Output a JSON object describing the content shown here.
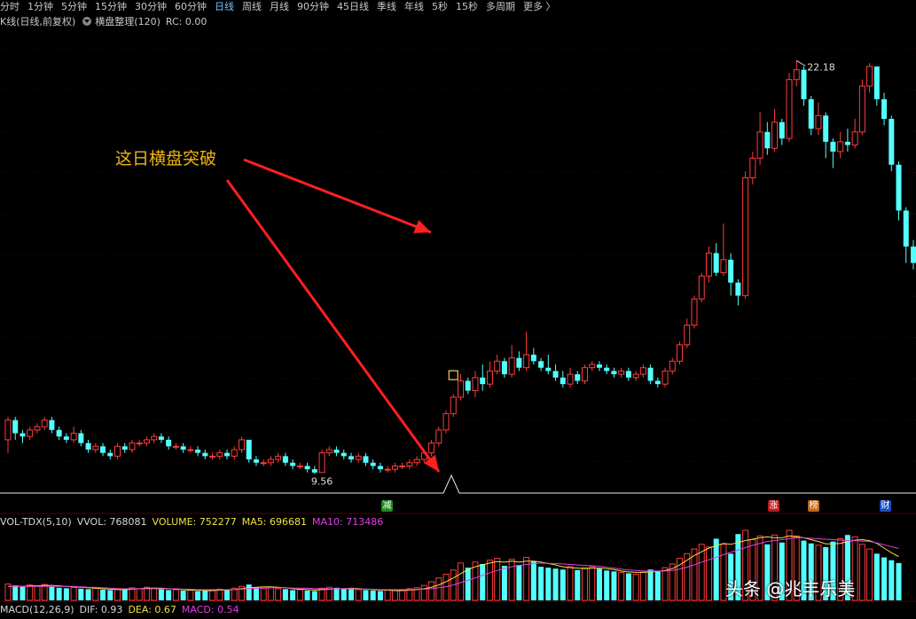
{
  "timeframes": [
    "分时",
    "1分钟",
    "5分钟",
    "15分钟",
    "30分钟",
    "60分钟",
    "日线",
    "周线",
    "月线",
    "90分钟",
    "45日线",
    "季线",
    "年线",
    "5秒",
    "15秒",
    "多周期",
    "更多 〉"
  ],
  "active_timeframe": "日线",
  "info_bar": {
    "chart_label": "K线(日线,前复权)",
    "indicator_label": "横盘整理(120)",
    "rc_label": "RC: 0.00"
  },
  "price_labels": {
    "high": "22.18",
    "low": "9.56"
  },
  "annotation": "这日横盘突破",
  "badges": [
    {
      "text": "减",
      "color": "#1f8a1f"
    },
    {
      "text": "涨",
      "color": "#c01818"
    },
    {
      "text": "榜",
      "color": "#c06818"
    },
    {
      "text": "财",
      "color": "#1a4fbf"
    }
  ],
  "volume_bar": {
    "name": "VOL-TDX(5,10)",
    "vvol": "VVOL: 768081",
    "volume": "VOLUME: 752277",
    "ma5": "MA5: 696681",
    "ma10": "MA10: 713486"
  },
  "macd_bar": {
    "name": "MACD(12,26,9)",
    "dif": "DIF: 0.93",
    "dea": "DEA: 0.67",
    "macd": "MACD: 0.54"
  },
  "watermark": "头条 @兆丰乐美",
  "colors": {
    "up": "#ff3c3c",
    "down": "#54ffff",
    "background": "#000000",
    "accent": "#f2b50e"
  },
  "chart_data": {
    "type": "candlestick",
    "title": "",
    "y_range": [
      9.0,
      23.0
    ],
    "candles": [
      [
        10.6,
        11.2,
        10.2,
        11.3
      ],
      [
        11.2,
        10.8,
        10.6,
        11.3
      ],
      [
        10.8,
        10.7,
        10.5,
        10.9
      ],
      [
        10.7,
        10.9,
        10.6,
        11.0
      ],
      [
        10.9,
        11.0,
        10.8,
        11.1
      ],
      [
        11.0,
        11.2,
        10.9,
        11.3
      ],
      [
        11.2,
        10.9,
        10.8,
        11.3
      ],
      [
        10.9,
        10.7,
        10.6,
        11.0
      ],
      [
        10.7,
        10.6,
        10.5,
        10.8
      ],
      [
        10.6,
        10.8,
        10.5,
        11.0
      ],
      [
        10.8,
        10.5,
        10.4,
        10.9
      ],
      [
        10.5,
        10.3,
        10.2,
        10.6
      ],
      [
        10.3,
        10.4,
        10.2,
        10.5
      ],
      [
        10.4,
        10.2,
        10.1,
        10.5
      ],
      [
        10.2,
        10.1,
        10.0,
        10.3
      ],
      [
        10.1,
        10.4,
        10.0,
        10.5
      ],
      [
        10.4,
        10.3,
        10.2,
        10.5
      ],
      [
        10.3,
        10.5,
        10.2,
        10.6
      ],
      [
        10.5,
        10.5,
        10.4,
        10.6
      ],
      [
        10.5,
        10.6,
        10.4,
        10.7
      ],
      [
        10.6,
        10.7,
        10.5,
        10.8
      ],
      [
        10.7,
        10.6,
        10.5,
        10.8
      ],
      [
        10.6,
        10.4,
        10.3,
        10.7
      ],
      [
        10.4,
        10.4,
        10.3,
        10.5
      ],
      [
        10.4,
        10.3,
        10.2,
        10.5
      ],
      [
        10.3,
        10.3,
        10.2,
        10.4
      ],
      [
        10.3,
        10.2,
        10.1,
        10.4
      ],
      [
        10.2,
        10.1,
        10.0,
        10.3
      ],
      [
        10.1,
        10.1,
        10.0,
        10.2
      ],
      [
        10.1,
        10.2,
        10.0,
        10.3
      ],
      [
        10.2,
        10.1,
        10.0,
        10.3
      ],
      [
        10.1,
        10.3,
        10.0,
        10.4
      ],
      [
        10.3,
        10.6,
        10.2,
        10.7
      ],
      [
        10.6,
        10.0,
        9.9,
        10.6
      ],
      [
        10.0,
        9.9,
        9.8,
        10.1
      ],
      [
        9.9,
        9.9,
        9.8,
        10.0
      ],
      [
        9.9,
        10.0,
        9.8,
        10.1
      ],
      [
        10.0,
        10.1,
        9.9,
        10.2
      ],
      [
        10.1,
        9.9,
        9.8,
        10.2
      ],
      [
        9.9,
        9.8,
        9.7,
        10.0
      ],
      [
        9.8,
        9.8,
        9.7,
        9.9
      ],
      [
        9.8,
        9.7,
        9.6,
        9.9
      ],
      [
        9.7,
        9.6,
        9.56,
        9.8
      ],
      [
        9.6,
        10.2,
        9.6,
        10.3
      ],
      [
        10.2,
        10.3,
        10.1,
        10.4
      ],
      [
        10.3,
        10.2,
        10.1,
        10.4
      ],
      [
        10.2,
        10.1,
        10.0,
        10.3
      ],
      [
        10.1,
        10.0,
        9.9,
        10.2
      ],
      [
        10.0,
        10.1,
        9.9,
        10.2
      ],
      [
        10.1,
        9.9,
        9.8,
        10.2
      ],
      [
        9.9,
        9.8,
        9.7,
        10.0
      ],
      [
        9.8,
        9.7,
        9.6,
        9.9
      ],
      [
        9.7,
        9.7,
        9.6,
        9.8
      ],
      [
        9.7,
        9.8,
        9.6,
        9.9
      ],
      [
        9.8,
        9.8,
        9.7,
        9.9
      ],
      [
        9.8,
        9.9,
        9.7,
        10.0
      ],
      [
        9.9,
        10.0,
        9.8,
        10.1
      ],
      [
        10.0,
        10.2,
        9.9,
        10.3
      ],
      [
        10.2,
        10.5,
        10.1,
        10.6
      ],
      [
        10.5,
        10.9,
        10.4,
        11.0
      ],
      [
        10.9,
        11.4,
        10.8,
        11.5
      ],
      [
        11.4,
        11.9,
        11.3,
        12.0
      ],
      [
        11.9,
        12.4,
        11.8,
        12.6
      ],
      [
        12.4,
        12.1,
        12.0,
        12.5
      ],
      [
        12.1,
        12.5,
        11.9,
        12.7
      ],
      [
        12.5,
        12.3,
        12.1,
        12.9
      ],
      [
        12.3,
        12.7,
        12.2,
        13.0
      ],
      [
        12.7,
        13.0,
        12.6,
        13.2
      ],
      [
        13.0,
        12.6,
        12.5,
        13.1
      ],
      [
        12.6,
        13.1,
        12.5,
        13.5
      ],
      [
        13.1,
        12.8,
        12.7,
        13.3
      ],
      [
        12.8,
        13.2,
        12.7,
        13.9
      ],
      [
        13.2,
        13.0,
        12.9,
        13.4
      ],
      [
        13.0,
        12.8,
        12.7,
        13.1
      ],
      [
        12.8,
        12.7,
        12.6,
        13.2
      ],
      [
        12.7,
        12.5,
        12.4,
        12.9
      ],
      [
        12.5,
        12.3,
        12.2,
        12.7
      ],
      [
        12.3,
        12.6,
        12.2,
        12.8
      ],
      [
        12.6,
        12.4,
        12.3,
        12.7
      ],
      [
        12.4,
        12.8,
        12.3,
        12.9
      ],
      [
        12.8,
        12.9,
        12.7,
        13.0
      ],
      [
        12.9,
        12.8,
        12.7,
        13.0
      ],
      [
        12.8,
        12.7,
        12.6,
        12.9
      ],
      [
        12.7,
        12.6,
        12.5,
        12.8
      ],
      [
        12.6,
        12.7,
        12.5,
        12.8
      ],
      [
        12.7,
        12.5,
        12.4,
        12.8
      ],
      [
        12.5,
        12.6,
        12.4,
        12.7
      ],
      [
        12.6,
        12.8,
        12.5,
        12.9
      ],
      [
        12.8,
        12.4,
        12.3,
        12.9
      ],
      [
        12.4,
        12.3,
        12.2,
        12.5
      ],
      [
        12.3,
        12.7,
        12.2,
        12.8
      ],
      [
        12.7,
        13.0,
        12.6,
        13.1
      ],
      [
        13.0,
        13.5,
        12.9,
        13.6
      ],
      [
        13.5,
        14.1,
        13.4,
        14.3
      ],
      [
        14.1,
        14.9,
        14.0,
        15.0
      ],
      [
        14.9,
        15.6,
        14.8,
        15.7
      ],
      [
        15.6,
        16.3,
        15.4,
        16.5
      ],
      [
        16.3,
        15.7,
        15.6,
        16.6
      ],
      [
        15.7,
        16.1,
        15.6,
        17.2
      ],
      [
        16.1,
        15.4,
        15.0,
        16.3
      ],
      [
        15.4,
        15.0,
        14.7,
        15.5
      ],
      [
        15.0,
        18.6,
        14.9,
        18.8
      ],
      [
        18.6,
        19.2,
        18.4,
        19.4
      ],
      [
        19.2,
        20.0,
        19.0,
        20.6
      ],
      [
        20.0,
        19.5,
        19.3,
        20.3
      ],
      [
        19.5,
        20.3,
        19.4,
        20.7
      ],
      [
        20.3,
        19.8,
        19.6,
        20.4
      ],
      [
        19.8,
        21.6,
        19.7,
        21.8
      ],
      [
        21.6,
        21.9,
        21.4,
        22.18
      ],
      [
        21.9,
        21.0,
        20.8,
        22.0
      ],
      [
        21.0,
        20.1,
        19.9,
        21.1
      ],
      [
        20.1,
        20.5,
        19.9,
        20.9
      ],
      [
        20.5,
        19.7,
        19.2,
        20.6
      ],
      [
        19.7,
        19.4,
        18.9,
        19.8
      ],
      [
        19.4,
        19.7,
        19.2,
        20.0
      ],
      [
        19.7,
        19.6,
        19.4,
        20.1
      ],
      [
        19.6,
        20.0,
        19.5,
        20.4
      ],
      [
        20.0,
        21.4,
        19.9,
        21.6
      ],
      [
        21.4,
        22.0,
        21.2,
        22.1
      ],
      [
        22.0,
        21.0,
        20.8,
        22.0
      ],
      [
        21.0,
        20.4,
        20.2,
        21.2
      ],
      [
        20.4,
        19.0,
        18.8,
        20.5
      ],
      [
        19.0,
        17.6,
        17.3,
        19.1
      ],
      [
        17.6,
        16.5,
        16.0,
        17.7
      ],
      [
        16.5,
        16.0,
        15.8,
        16.7
      ]
    ],
    "volume": [
      35,
      32,
      30,
      33,
      31,
      34,
      29,
      27,
      26,
      28,
      25,
      24,
      26,
      23,
      22,
      25,
      24,
      27,
      25,
      28,
      26,
      24,
      22,
      23,
      21,
      22,
      20,
      21,
      22,
      24,
      23,
      26,
      30,
      34,
      28,
      26,
      27,
      25,
      24,
      22,
      23,
      21,
      20,
      26,
      28,
      27,
      25,
      24,
      23,
      22,
      21,
      20,
      22,
      21,
      23,
      25,
      27,
      32,
      40,
      48,
      56,
      65,
      80,
      70,
      82,
      78,
      86,
      90,
      74,
      88,
      76,
      92,
      84,
      72,
      70,
      68,
      66,
      72,
      65,
      70,
      72,
      68,
      64,
      62,
      60,
      58,
      56,
      60,
      66,
      62,
      70,
      78,
      90,
      100,
      110,
      120,
      114,
      132,
      120,
      100,
      142,
      150,
      130,
      138,
      120,
      140,
      124,
      150,
      138,
      128,
      122,
      118,
      114,
      126,
      132,
      140,
      136,
      120,
      110,
      100,
      92,
      86,
      80
    ],
    "volume_ma5": [
      30,
      30,
      30,
      31,
      31,
      32,
      32,
      31,
      30,
      29,
      28,
      27,
      26,
      25,
      24,
      23,
      23,
      24,
      25,
      26,
      26,
      26,
      25,
      24,
      23,
      22,
      22,
      21,
      21,
      22,
      22,
      23,
      25,
      27,
      28,
      29,
      29,
      28,
      27,
      25,
      24,
      23,
      22,
      23,
      24,
      25,
      25,
      26,
      25,
      24,
      23,
      22,
      22,
      21,
      21,
      22,
      23,
      25,
      28,
      33,
      40,
      48,
      57,
      66,
      72,
      76,
      80,
      83,
      82,
      84,
      82,
      84,
      84,
      82,
      79,
      76,
      72,
      70,
      69,
      68,
      69,
      69,
      68,
      66,
      63,
      61,
      60,
      60,
      61,
      62,
      64,
      68,
      76,
      86,
      96,
      104,
      112,
      117,
      122,
      120,
      124,
      128,
      131,
      134,
      136,
      134,
      134,
      138,
      136,
      134,
      130,
      126,
      121,
      121,
      122,
      126,
      129,
      130,
      128,
      122,
      112,
      102,
      94
    ],
    "volume_ma10": [
      30,
      30,
      30,
      30,
      30,
      30,
      30,
      30,
      30,
      30,
      29,
      28,
      28,
      27,
      26,
      25,
      25,
      25,
      25,
      25,
      25,
      25,
      25,
      25,
      24,
      24,
      23,
      23,
      23,
      23,
      23,
      23,
      24,
      25,
      26,
      26,
      27,
      27,
      27,
      26,
      26,
      26,
      25,
      25,
      25,
      25,
      25,
      25,
      24,
      24,
      24,
      23,
      23,
      23,
      23,
      23,
      24,
      24,
      25,
      27,
      29,
      33,
      38,
      43,
      48,
      54,
      59,
      64,
      68,
      72,
      75,
      77,
      79,
      80,
      79,
      79,
      78,
      77,
      76,
      75,
      74,
      73,
      71,
      69,
      67,
      65,
      64,
      63,
      63,
      63,
      63,
      64,
      67,
      71,
      76,
      82,
      87,
      92,
      98,
      103,
      108,
      113,
      118,
      122,
      126,
      128,
      130,
      132,
      134,
      134,
      133,
      132,
      131,
      130,
      129,
      128,
      128,
      127,
      126,
      123,
      119,
      115,
      111
    ]
  }
}
